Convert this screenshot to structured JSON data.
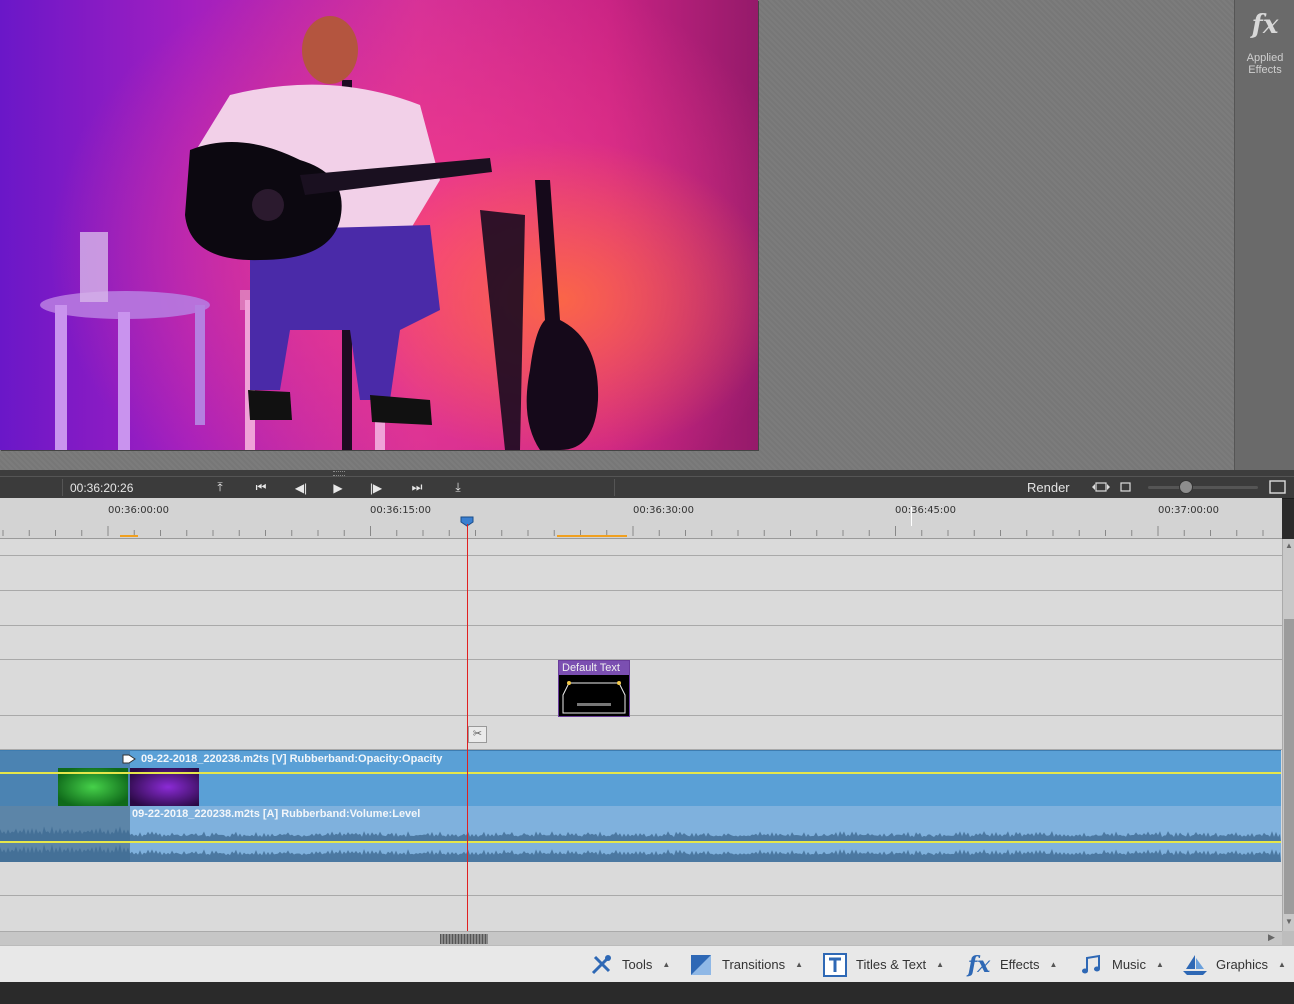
{
  "monitor": {
    "effects_panel": {
      "icon_text": "fx",
      "label": "Applied Effects"
    }
  },
  "transport": {
    "timecode": "00:36:20:26",
    "buttons": [
      {
        "name": "goto-in-button",
        "glyph": "⤒"
      },
      {
        "name": "goto-start-button",
        "glyph": "⏮"
      },
      {
        "name": "step-back-button",
        "glyph": "◀|"
      },
      {
        "name": "play-button",
        "glyph": "▶"
      },
      {
        "name": "step-forward-button",
        "glyph": "|▶"
      },
      {
        "name": "goto-end-button",
        "glyph": "⏭"
      },
      {
        "name": "goto-out-button",
        "glyph": "⤓"
      }
    ],
    "render_label": "Render"
  },
  "ruler": {
    "labels": [
      "00:36:00:00",
      "00:36:15:00",
      "00:36:30:00",
      "00:36:45:00",
      "00:37:00:00"
    ]
  },
  "timeline": {
    "title_clip": {
      "label": "Default Text"
    },
    "video_clip": {
      "label": "09-22-2018_220238.m2ts [V] Rubberband:Opacity:Opacity"
    },
    "audio_clip": {
      "label": "09-22-2018_220238.m2ts [A] Rubberband:Volume:Level"
    }
  },
  "toolbar": {
    "tools": "Tools",
    "transitions": "Transitions",
    "titles": "Titles & Text",
    "effects": "Effects",
    "effects_icon": "fx",
    "music": "Music",
    "graphics": "Graphics"
  },
  "colors": {
    "playhead": "#e02020",
    "video_clip": "#5aa0d6",
    "audio_clip": "#7fb1dd",
    "title_clip_header": "#7b4fb1",
    "rubberband": "#e6e64a"
  }
}
